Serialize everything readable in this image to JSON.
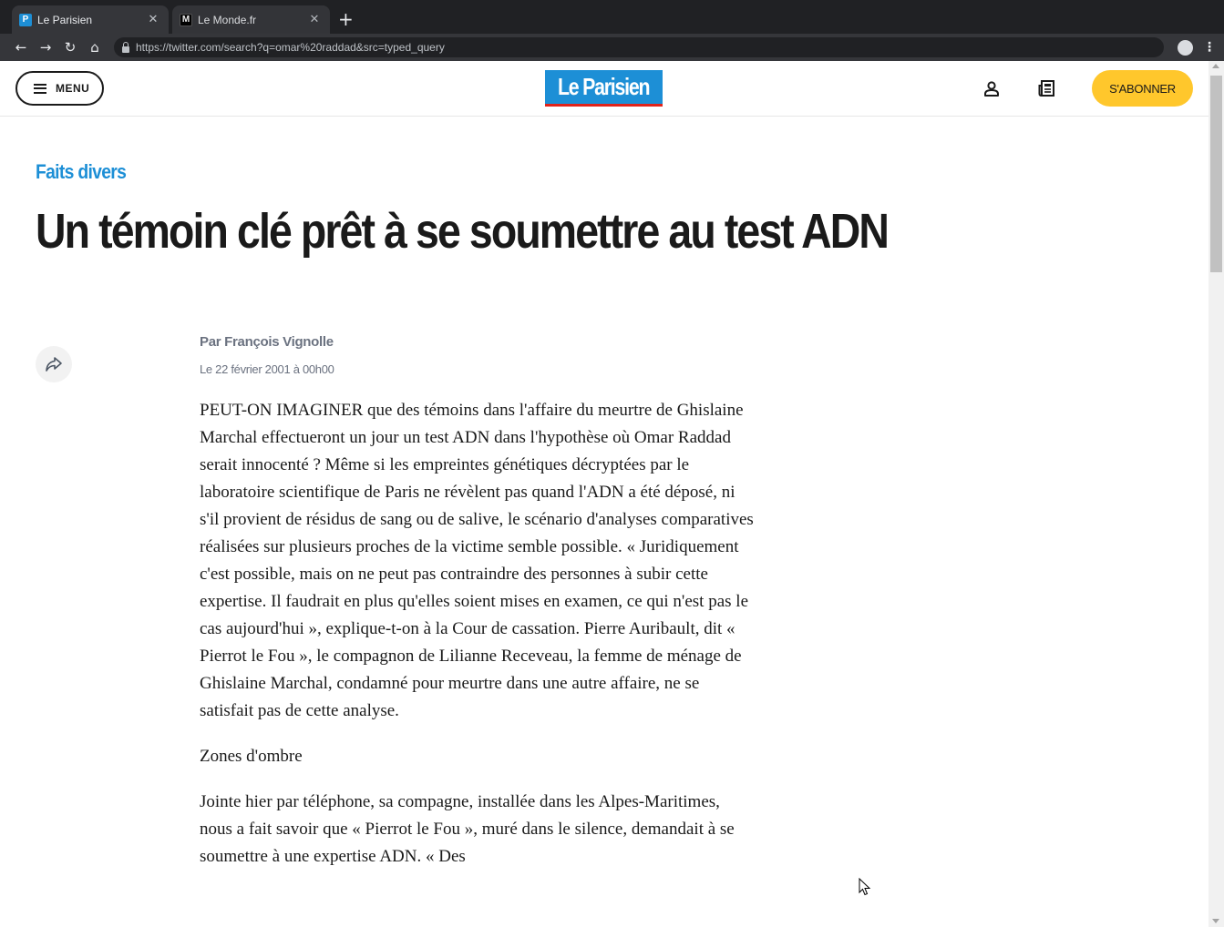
{
  "browser": {
    "tabs": [
      {
        "title": "Le Parisien",
        "favicon": "P",
        "favicon_color": "#1d8fd6",
        "active": true
      },
      {
        "title": "Le Monde.fr",
        "favicon": "M",
        "favicon_color": "#000000",
        "active": false
      }
    ],
    "close_glyph": "✕",
    "new_tab_glyph": "+",
    "url": "https://twitter.com/search?q=omar%20raddad&src=typed_query",
    "nav": {
      "back": "←",
      "forward": "→",
      "reload": "↻",
      "home": "⌂"
    },
    "kebab": "⋮"
  },
  "site": {
    "menu_label": "MENU",
    "logo_text": "Le Parisien",
    "subscribe_label": "S'ABONNER",
    "brand_colors": {
      "blue": "#1d8fd6",
      "red": "#e2231a",
      "yellow": "#ffc72c"
    }
  },
  "article": {
    "rubric": "Faits divers",
    "headline": "Un témoin clé prêt à se soumettre au test ADN",
    "byline": "Par François Vignolle",
    "date": "Le 22 février 2001 à 00h00",
    "paragraphs": [
      "PEUT-ON IMAGINER que des témoins dans l'affaire du meurtre de Ghislaine Marchal effectueront un jour un test ADN dans l'hypothèse où Omar Raddad serait innocenté ? Même si les empreintes génétiques décryptées par le laboratoire scientifique de Paris ne révèlent pas quand l'ADN a été déposé, ni s'il provient de résidus de sang ou de salive, le scénario d'analyses comparatives réalisées sur plusieurs proches de la victime semble possible. « Juridiquement c'est possible, mais on ne peut pas contraindre des personnes à subir cette expertise. Il faudrait en plus qu'elles soient mises en examen, ce qui n'est pas le cas aujourd'hui », explique-t-on à la Cour de cassation. Pierre Auribault, dit « Pierrot le Fou », le compagnon de Lilianne Receveau, la femme de ménage de Ghislaine Marchal, condamné pour meurtre dans une autre affaire, ne se satisfait pas de cette analyse.",
      "Zones d'ombre",
      "Jointe hier par téléphone, sa compagne, installée dans les Alpes-Maritimes, nous a fait savoir que « Pierrot le Fou », muré dans le silence, demandait à se soumettre à une expertise ADN. « Des"
    ]
  }
}
